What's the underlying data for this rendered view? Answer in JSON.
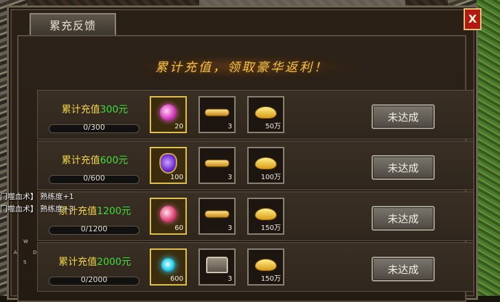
{
  "dialog": {
    "title": "累充反馈",
    "close_label": "X",
    "banner": "累计充值，领取豪华返利！"
  },
  "rows": [
    {
      "prefix": "累计充值",
      "amount": "300元",
      "progress_text": "0/300",
      "progress_fraction": 0,
      "button": "未达成",
      "rewards": [
        {
          "icon": "pink-orb-icon",
          "count": "20",
          "highlight": true
        },
        {
          "icon": "scroll-icon",
          "count": "3",
          "highlight": false
        },
        {
          "icon": "gold-ingot-icon",
          "count": "50万",
          "highlight": false
        }
      ]
    },
    {
      "prefix": "累计充值",
      "amount": "600元",
      "progress_text": "0/600",
      "progress_fraction": 0,
      "button": "未达成",
      "rewards": [
        {
          "icon": "purple-gem-icon",
          "count": "100",
          "highlight": true
        },
        {
          "icon": "scroll-icon",
          "count": "3",
          "highlight": false
        },
        {
          "icon": "gold-ingot-icon",
          "count": "100万",
          "highlight": false
        }
      ]
    },
    {
      "prefix": "累计充值",
      "amount": "1200元",
      "progress_text": "0/1200",
      "progress_fraction": 0,
      "button": "未达成",
      "rewards": [
        {
          "icon": "red-orb-icon",
          "count": "60",
          "highlight": true
        },
        {
          "icon": "scroll-icon",
          "count": "3",
          "highlight": false
        },
        {
          "icon": "gold-ingot-icon",
          "count": "150万",
          "highlight": false
        }
      ]
    },
    {
      "prefix": "累计充值",
      "amount": "2000元",
      "progress_text": "0/2000",
      "progress_fraction": 0,
      "button": "未达成",
      "rewards": [
        {
          "icon": "cyan-orb-icon",
          "count": "600",
          "highlight": true
        },
        {
          "icon": "chest-icon",
          "count": "3",
          "highlight": false
        },
        {
          "icon": "gold-ingot-icon",
          "count": "150万",
          "highlight": false
        }
      ]
    }
  ],
  "chat": {
    "lines": [
      "门噬血术】 熟练度+1",
      "门噬血术】 熟练度+3"
    ]
  },
  "wasd": {
    "w": "W",
    "a": "A",
    "s": "S",
    "d": "D"
  },
  "colors": {
    "label_yellow": "#f1d64a",
    "amount_green": "#3fe03a",
    "banner_gold": "#f0c04a",
    "close_red": "#b11a12"
  }
}
